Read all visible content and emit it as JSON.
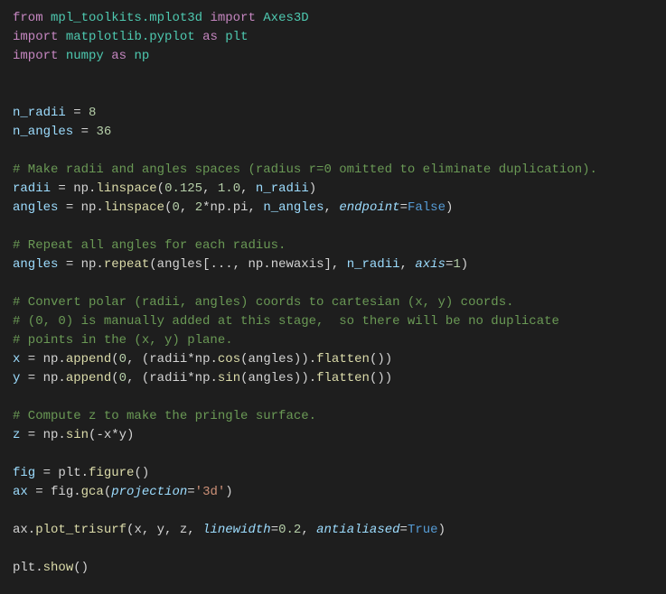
{
  "lines": {
    "l1_from": "from",
    "l1_mpl": "mpl_toolkits.mplot3d",
    "l1_import": "import",
    "l1_axes3d": "Axes3D",
    "l2_import": "import",
    "l2_mpl": "matplotlib.pyplot",
    "l2_as": "as",
    "l2_plt": "plt",
    "l3_import": "import",
    "l3_numpy": "numpy",
    "l3_as": "as",
    "l3_np": "np",
    "l6_var": "n_radii",
    "l6_eq": " = ",
    "l6_val": "8",
    "l7_var": "n_angles",
    "l7_eq": " = ",
    "l7_val": "36",
    "c1": "# Make radii and angles spaces (radius r=0 omitted to eliminate duplication).",
    "l10_var": "radii",
    "l10_rest_a": " = np.",
    "l10_fn": "linspace",
    "l10_open": "(",
    "l10_arg1": "0.125",
    "l10_c1": ", ",
    "l10_arg2": "1.0",
    "l10_c2": ", ",
    "l10_arg3": "n_radii",
    "l10_close": ")",
    "l11_var": "angles",
    "l11_rest_a": " = np.",
    "l11_fn": "linspace",
    "l11_open": "(",
    "l11_arg1": "0",
    "l11_c1": ", ",
    "l11_arg2a": "2",
    "l11_arg2b": "*np.pi, ",
    "l11_arg3": "n_angles",
    "l11_c3": ", ",
    "l11_kwarg": "endpoint",
    "l11_eq": "=",
    "l11_false": "False",
    "l11_close": ")",
    "c2": "# Repeat all angles for each radius.",
    "l14_var": "angles",
    "l14_rest_a": " = np.",
    "l14_fn": "repeat",
    "l14_open": "(angles[..., np.newaxis], ",
    "l14_arg": "n_radii",
    "l14_c": ", ",
    "l14_kwarg": "axis",
    "l14_eq": "=",
    "l14_val": "1",
    "l14_close": ")",
    "c3": "# Convert polar (radii, angles) coords to cartesian (x, y) coords.",
    "c4": "# (0, 0) is manually added at this stage,  so there will be no duplicate",
    "c5": "# points in the (x, y) plane.",
    "l19_var": "x",
    "l19_a": " = np.",
    "l19_fn": "append",
    "l19_open": "(",
    "l19_zero": "0",
    "l19_mid": ", (radii*np.",
    "l19_cos": "cos",
    "l19_after": "(angles)).",
    "l19_flat": "flatten",
    "l19_close": "())",
    "l20_var": "y",
    "l20_a": " = np.",
    "l20_fn": "append",
    "l20_open": "(",
    "l20_zero": "0",
    "l20_mid": ", (radii*np.",
    "l20_sin": "sin",
    "l20_after": "(angles)).",
    "l20_flat": "flatten",
    "l20_close": "())",
    "c6": "# Compute z to make the pringle surface.",
    "l23_var": "z",
    "l23_a": " = np.",
    "l23_fn": "sin",
    "l23_args": "(-x*y)",
    "l25_var": "fig",
    "l25_a": " = plt.",
    "l25_fn": "figure",
    "l25_p": "()",
    "l26_var": "ax",
    "l26_a": " = fig.",
    "l26_fn": "gca",
    "l26_open": "(",
    "l26_kwarg": "projection",
    "l26_eq": "=",
    "l26_str": "'3d'",
    "l26_close": ")",
    "l28_a": "ax.",
    "l28_fn": "plot_trisurf",
    "l28_open": "(x, y, z, ",
    "l28_kw1": "linewidth",
    "l28_eq1": "=",
    "l28_v1": "0.2",
    "l28_c": ", ",
    "l28_kw2": "antialiased",
    "l28_eq2": "=",
    "l28_true": "True",
    "l28_close": ")",
    "l30_a": "plt.",
    "l30_fn": "show",
    "l30_p": "()"
  }
}
